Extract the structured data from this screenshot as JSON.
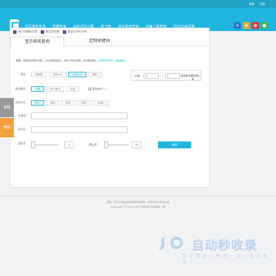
{
  "topbar": {
    "login": "登录",
    "register": "注册"
  },
  "nav": {
    "items": [
      "宝贝排名查询",
      "批量查询",
      "动态评分计算",
      "查下架",
      "淘宝类目查询",
      "店铺上新查询",
      "TOP20W词表"
    ],
    "social_icons": [
      "plus-icon",
      "star-icon",
      "weibo-icon",
      "wechat-icon"
    ]
  },
  "quick_links": [
    "淘口令解析还原",
    "查买家信誉",
    "查宝贝评分分析"
  ],
  "tabs": [
    "宝贝排名查询",
    "定制关键词"
  ],
  "notice": {
    "text": "提醒：如需查询更多页数，100页需扣积分，排名个性化结果，查询需谨慎！",
    "link": "(无须购买积分，复制网址)"
  },
  "filters": {
    "platform": {
      "label": "筛选：",
      "options": [
        "电脑版",
        "天猫app",
        "淘宝app",
        "搜券"
      ],
      "selected": 2
    },
    "mode": {
      "label": "查询模式：",
      "options": [
        "店铺",
        "单个宝贝",
        "红包"
      ],
      "selected": 0
    },
    "simulate": {
      "label": "模拟登录",
      "hint": "(?)"
    },
    "sort": {
      "label": "排序方式：",
      "options": [
        "默认",
        "销量",
        "信用",
        "价格↑",
        "价格↓"
      ],
      "selected": 0
    }
  },
  "price": {
    "label": "价格：",
    "min": "0",
    "max": "0",
    "dash": "-",
    "select1": "筛选条件▼",
    "select2": "发货地▼"
  },
  "keyword": {
    "label": "关键词：",
    "value": ""
  },
  "shop": {
    "label": "旺旺号：",
    "value": ""
  },
  "range": {
    "start_label": "起始页：",
    "start_value": "1",
    "end_label": "终止页：",
    "end_value": "20",
    "button": "查询"
  },
  "side": {
    "contact": "客服",
    "tutorial": "教程"
  },
  "footer": {
    "line1": "说明：本站不保证查询结果的准确性，实际排名以淘宝为准",
    "line2": "Copyright © 2011-2020 淘宝查询  查询排名工具"
  },
  "watermark": {
    "brand": "自动秒收录",
    "tagline": "做 上 精 品 → 来 访 一 次 → 自 动 收 录"
  }
}
